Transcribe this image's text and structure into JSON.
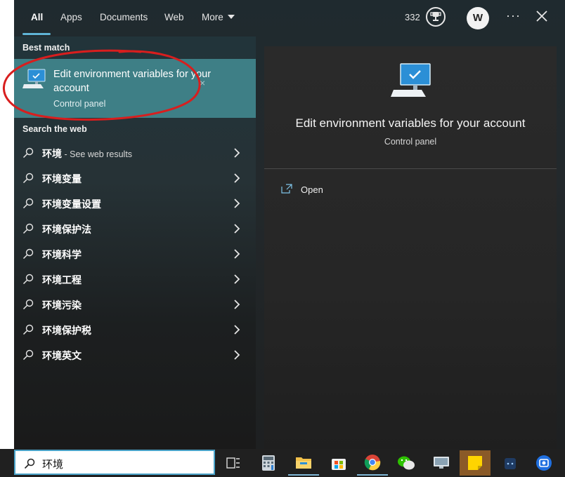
{
  "tabs": [
    {
      "label": "All",
      "active": true
    },
    {
      "label": "Apps"
    },
    {
      "label": "Documents"
    },
    {
      "label": "Web"
    },
    {
      "label": "More"
    }
  ],
  "header": {
    "points": "332",
    "avatar_letter": "W",
    "more_options": "···"
  },
  "best_match": {
    "section_label": "Best match",
    "title": "Edit environment variables for your account",
    "subtitle": "Control panel",
    "dismiss": "×"
  },
  "web": {
    "section_label": "Search the web",
    "items": [
      {
        "text": "环境",
        "hint": " - See web results"
      },
      {
        "text": "环境变量"
      },
      {
        "text": "环境变量设置"
      },
      {
        "text": "环境保护法"
      },
      {
        "text": "环境科学"
      },
      {
        "text": "环境工程"
      },
      {
        "text": "环境污染"
      },
      {
        "text": "环境保护税"
      },
      {
        "text": "环境英文"
      }
    ]
  },
  "preview": {
    "title": "Edit environment variables for your account",
    "subtitle": "Control panel",
    "actions": [
      {
        "label": "Open"
      }
    ]
  },
  "search": {
    "query": "环境"
  },
  "taskbar": {
    "icons": [
      "task-view-icon",
      "calculator-icon",
      "file-explorer-icon",
      "microsoft-store-icon",
      "chrome-icon",
      "wechat-icon",
      "remote-desktop-icon",
      "sticky-notes-icon",
      "game-icon",
      "app-icon"
    ]
  },
  "colors": {
    "accent": "#5fb4d6",
    "best_match_bg": "#3e7f86",
    "annotation_red": "#d81e1e"
  }
}
